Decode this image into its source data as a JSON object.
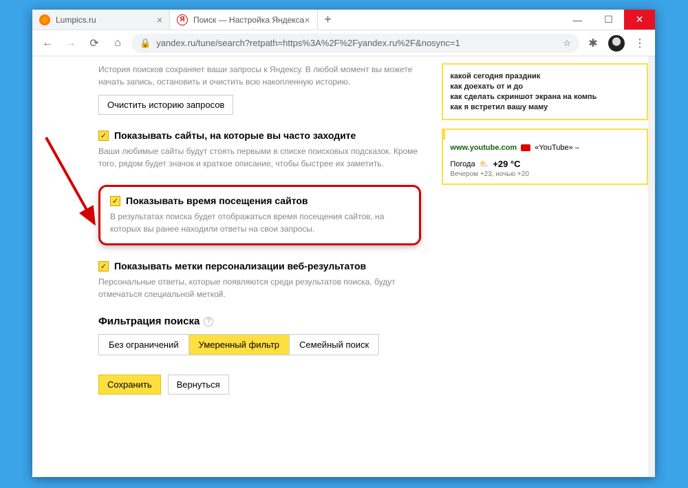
{
  "tabs": {
    "t1": "Lumpics.ru",
    "t2": "Поиск — Настройка Яндекса"
  },
  "url": "yandex.ru/tune/search?retpath=https%3A%2F%2Fyandex.ru%2F&nosync=1",
  "history": {
    "desc": "История поисков сохраняет ваши запросы к Яндексу. В любой момент вы можете начать запись, остановить и очистить всю накопленную историю.",
    "clear": "Очистить историю запросов"
  },
  "opt1": {
    "label": "Показывать сайты, на которые вы часто заходите",
    "desc": "Ваши любимые сайты будут стоять первыми в списке поисковых подсказок. Кроме того, рядом будет значок и краткое описание, чтобы быстрее их заметить."
  },
  "opt2": {
    "label": "Показывать время посещения сайтов",
    "desc": "В результатах поиска будет отображаться время посещения сайтов, на которых вы ранее находили ответы на свои запросы."
  },
  "opt3": {
    "label": "Показывать метки персонализации веб-результатов",
    "desc": "Персональные ответы, которые появляются среди результатов поиска, будут отмечаться специальной меткой."
  },
  "filter": {
    "title": "Фильтрация поиска",
    "o1": "Без ограничений",
    "o2": "Умеренный фильтр",
    "o3": "Семейный поиск"
  },
  "save": "Сохранить",
  "back": "Вернуться",
  "sugg": {
    "s1": "какой сегодня праздник",
    "s2": "как доехать от и до",
    "s3": "как сделать скриншот экрана на компь",
    "s4": "как я встретил вашу маму"
  },
  "ytbox": {
    "url": "www.youtube.com",
    "name": "«YouTube» –",
    "weather_label": "Погода",
    "temp": "+29 °C",
    "forecast": "Вечером +23, ночью +20"
  }
}
